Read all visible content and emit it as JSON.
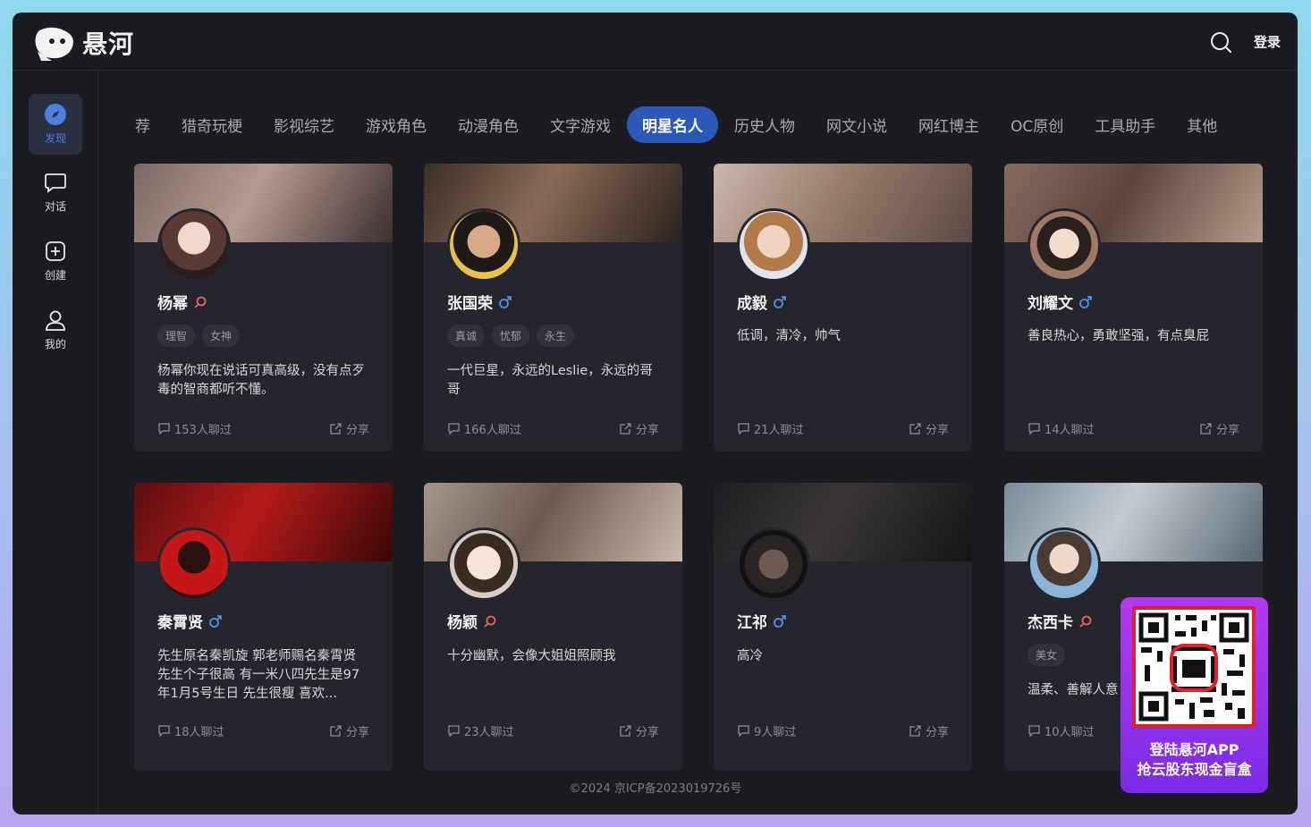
{
  "app": {
    "name": "悬河"
  },
  "header": {
    "login_label": "登录"
  },
  "sidebar": {
    "items": [
      {
        "label": "发现",
        "icon": "compass-icon",
        "active": true
      },
      {
        "label": "对话",
        "icon": "chat-icon"
      },
      {
        "label": "创建",
        "icon": "plus-square-icon"
      },
      {
        "label": "我的",
        "icon": "user-icon"
      }
    ]
  },
  "tabs": [
    "荐",
    "猎奇玩梗",
    "影视综艺",
    "游戏角色",
    "动漫角色",
    "文字游戏",
    "明星名人",
    "历史人物",
    "网文小说",
    "网红博主",
    "OC原创",
    "工具助手",
    "其他"
  ],
  "active_tab": "明星名人",
  "share_label": "分享",
  "cards": [
    {
      "name": "杨幂",
      "gender": "female",
      "tags": [
        "理智",
        "女神"
      ],
      "desc": "杨幂你现在说话可真高级，没有点歹毒的智商都听不懂。",
      "chats": "153人聊过"
    },
    {
      "name": "张国荣",
      "gender": "male",
      "tags": [
        "真诚",
        "忧郁",
        "永生"
      ],
      "desc": "一代巨星，永远的Leslie，永远的哥哥",
      "chats": "166人聊过"
    },
    {
      "name": "成毅",
      "gender": "male",
      "tags": [],
      "desc": "低调，清冷，帅气",
      "chats": "21人聊过"
    },
    {
      "name": "刘耀文",
      "gender": "male",
      "tags": [],
      "desc": "善良热心，勇敢坚强，有点臭屁",
      "chats": "14人聊过"
    },
    {
      "name": "秦霄贤",
      "gender": "male",
      "tags": [],
      "desc": "先生原名秦凯旋 郭老师赐名秦霄贤 先生个子很高 有一米八四先生是97年1月5号生日 先生很瘦 喜欢...",
      "chats": "18人聊过"
    },
    {
      "name": "杨颖",
      "gender": "female",
      "tags": [],
      "desc": "十分幽默，会像大姐姐照顾我",
      "chats": "23人聊过"
    },
    {
      "name": "江祁",
      "gender": "male",
      "tags": [],
      "desc": "高冷",
      "chats": "9人聊过"
    },
    {
      "name": "杰西卡",
      "gender": "female",
      "tags": [
        "美女"
      ],
      "desc": "温柔、善解人意",
      "chats": "10人聊过"
    }
  ],
  "footer": {
    "copyright": "©2024 京ICP备2023019726号"
  },
  "qr_promo": {
    "line1": "登陆悬河APP",
    "line2": "抢云股东现金盲盒"
  },
  "colors": {
    "accent": "#2c58b8",
    "female": "#e8635f",
    "male": "#4f8fe8",
    "promo": "#a334ee"
  }
}
